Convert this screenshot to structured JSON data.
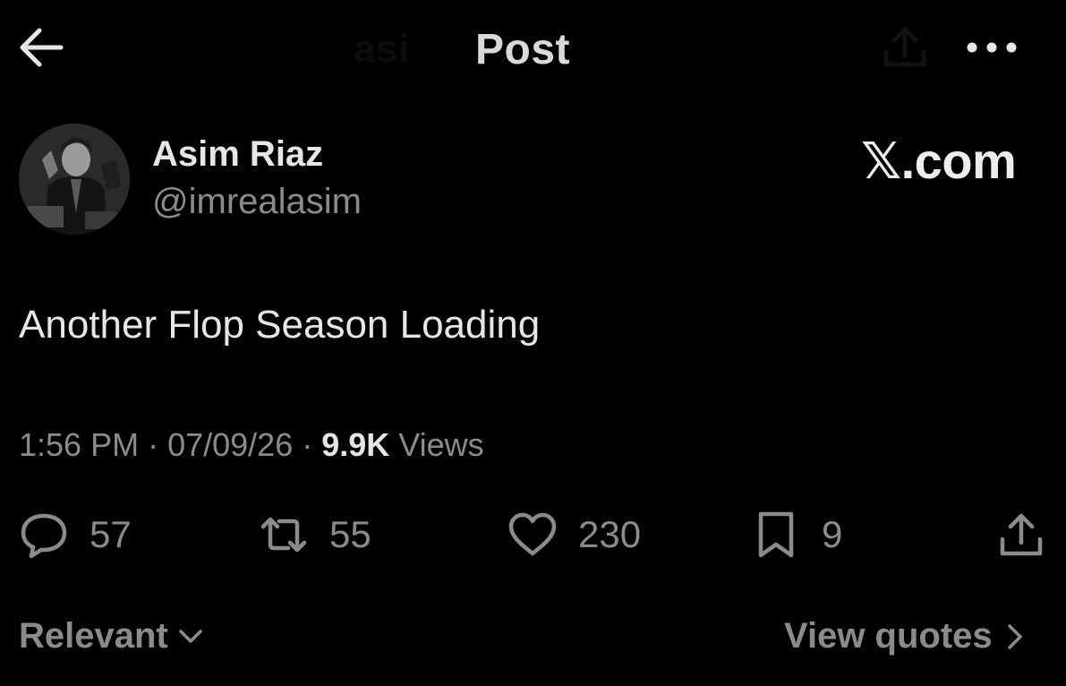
{
  "header": {
    "title": "Post",
    "ghost_title": "asi"
  },
  "author": {
    "name": "Asim Riaz",
    "handle": "@imrealasim"
  },
  "watermark": "𝕏.com",
  "post": {
    "text": "Another Flop Season Loading"
  },
  "meta": {
    "time": "1:56 PM",
    "separator": " · ",
    "date": "07/09/26",
    "views_count": "9.9K",
    "views_label": " Views"
  },
  "actions": {
    "replies": "57",
    "reposts": "55",
    "likes": "230",
    "bookmarks": "9"
  },
  "footer": {
    "sort_label": "Relevant",
    "quotes_label": "View quotes"
  },
  "icons": {
    "back": "arrow-left-icon",
    "share": "share-icon",
    "more": "more-dots-icon",
    "reply": "reply-icon",
    "repost": "repost-icon",
    "like": "heart-icon",
    "bookmark": "bookmark-icon",
    "chevron_down": "chevron-down-icon",
    "chevron_right": "chevron-right-icon"
  },
  "colors": {
    "background": "#000000",
    "primary_text": "#e6e6e6",
    "secondary_text": "#8b8b8b"
  }
}
